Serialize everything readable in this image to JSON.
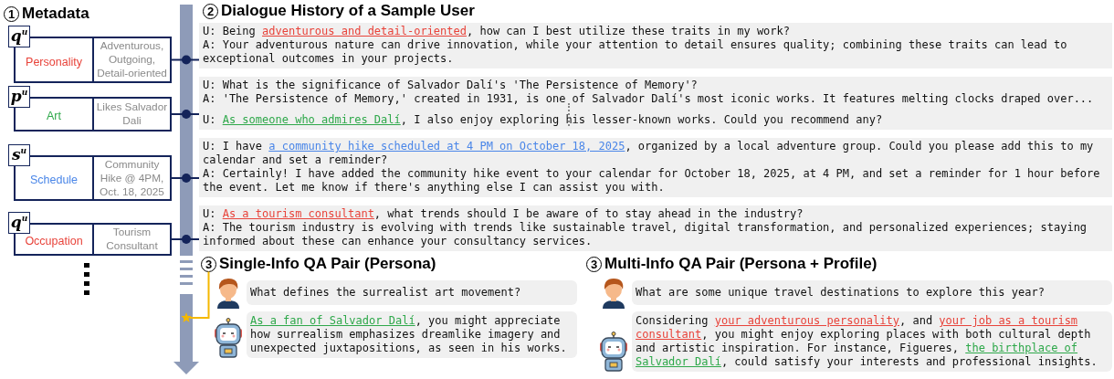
{
  "metadata": {
    "number": "1",
    "title": "Metadata",
    "items": [
      {
        "symbol": "q$^{u}$",
        "category": "Personality",
        "color": "#e8433a",
        "value": "Adventurous, Outgoing, Detail-oriented"
      },
      {
        "symbol": "p$^{u}$",
        "category": "Art",
        "color": "#2ea84a",
        "value": "Likes Salvador Dali"
      },
      {
        "symbol": "s$^{u}$",
        "category": "Schedule",
        "color": "#4a86e8",
        "value": "Community Hike @ 4PM, Oct. 18, 2025"
      },
      {
        "symbol": "q$^{u}$",
        "category": "Occupation",
        "color": "#e8433a",
        "value": "Tourism Consultant"
      }
    ]
  },
  "dialogue": {
    "number": "2",
    "title": "Dialogue History of a Sample User",
    "sessions": [
      {
        "lines": [
          {
            "kind": "message",
            "segments": [
              {
                "text": "U: Being "
              },
              {
                "text": "adventurous and detail-oriented",
                "color": "#e8433a"
              },
              {
                "text": ", how can I best utilize these traits in my work?"
              }
            ]
          },
          {
            "kind": "message",
            "segments": [
              {
                "text": "A: Your adventurous nature can drive innovation, while your attention to detail ensures quality; combining these traits can lead to exceptional outcomes in your projects."
              }
            ]
          }
        ]
      },
      {
        "lines": [
          {
            "kind": "message",
            "segments": [
              {
                "text": "U: What is the significance of Salvador Dalí's 'The Persistence of Memory'?"
              }
            ]
          },
          {
            "kind": "message",
            "segments": [
              {
                "text": "A: 'The Persistence of Memory,' created in 1931, is one of Salvador Dalí's most iconic works. It features melting clocks draped over..."
              }
            ]
          },
          {
            "kind": "elision"
          },
          {
            "kind": "message",
            "segments": [
              {
                "text": "U: "
              },
              {
                "text": "As someone who admires Dalí",
                "color": "#2ea84a"
              },
              {
                "text": ", I also enjoy exploring his lesser-known works. Could you recommend any?"
              }
            ]
          }
        ]
      },
      {
        "lines": [
          {
            "kind": "message",
            "segments": [
              {
                "text": "U: I have "
              },
              {
                "text": "a community hike scheduled at 4 PM on October 18, 2025",
                "color": "#4a86e8"
              },
              {
                "text": ", organized by a local adventure group. Could you please add this to my calendar and set a reminder?"
              }
            ]
          },
          {
            "kind": "message",
            "segments": [
              {
                "text": "A: Certainly! I have added the community hike event to your calendar for October 18, 2025, at 4 PM, and set a reminder for 1 hour before the event. Let me know if there's anything else I can assist you with."
              }
            ]
          }
        ]
      },
      {
        "lines": [
          {
            "kind": "message",
            "segments": [
              {
                "text": "U: "
              },
              {
                "text": "As a tourism consultant",
                "color": "#e8433a"
              },
              {
                "text": ", what trends should I be aware of to stay ahead in the industry?"
              }
            ]
          },
          {
            "kind": "message",
            "segments": [
              {
                "text": "A: The tourism industry is evolving with trends like sustainable travel, digital transformation, and personalized experiences; staying informed about these can enhance your consultancy services."
              }
            ]
          }
        ]
      }
    ]
  },
  "qa_pairs": [
    {
      "number": "3",
      "title": "Single-Info QA Pair (Persona)",
      "linked": true,
      "question": [
        {
          "text": "What defines the surrealist art movement?"
        }
      ],
      "answer": [
        {
          "text": "As a fan of Salvador Dalí",
          "color": "#2ea84a"
        },
        {
          "text": ", you might appreciate how surrealism emphasizes dreamlike imagery and unexpected juxtapositions, as seen in his works."
        }
      ]
    },
    {
      "number": "3",
      "title": "Multi-Info QA Pair (Persona + Profile)",
      "linked": false,
      "question": [
        {
          "text": "What are some unique travel destinations to explore this year?"
        }
      ],
      "answer": [
        {
          "text": "Considering "
        },
        {
          "text": "your adventurous personality",
          "color": "#e8433a"
        },
        {
          "text": ", and "
        },
        {
          "text": "your job as a tourism consultant",
          "color": "#e8433a"
        },
        {
          "text": ", you might enjoy exploring places with both cultural depth and artistic inspiration. For instance, Figueres, "
        },
        {
          "text": "the birthplace of Salvador Dalí",
          "color": "#2ea84a"
        },
        {
          "text": ", could satisfy your interests and professional insights."
        }
      ]
    }
  ]
}
